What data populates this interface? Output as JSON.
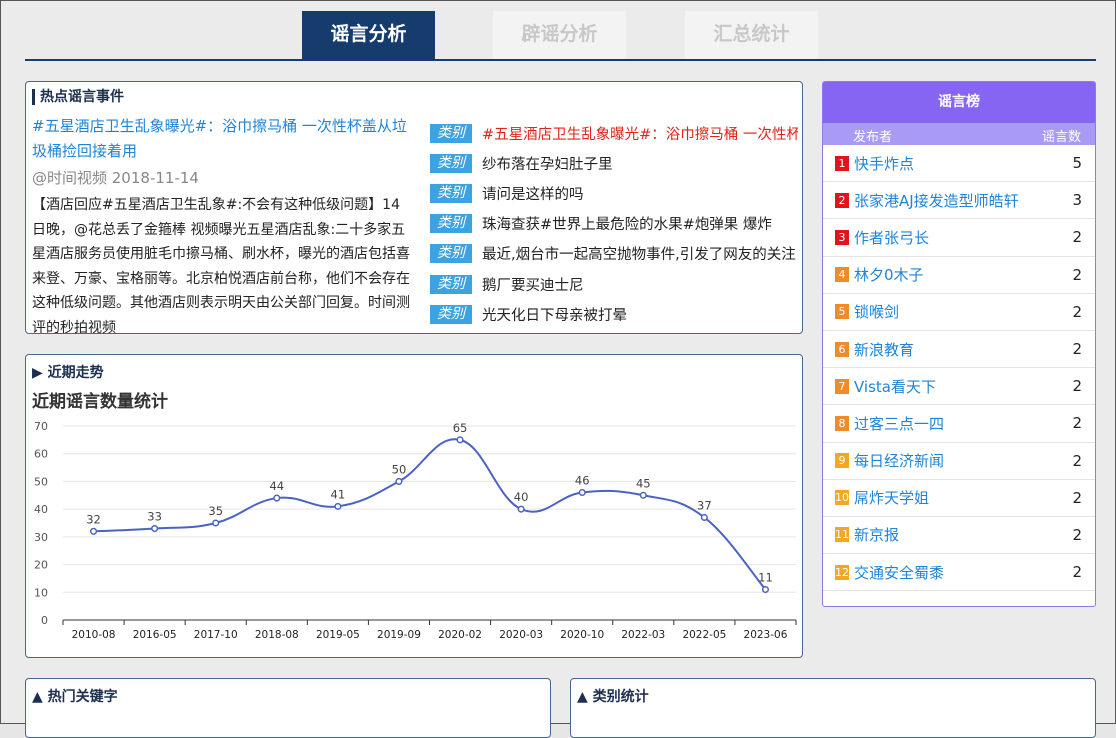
{
  "tabs": [
    {
      "label": "谣言分析"
    },
    {
      "label": "辟谣分析"
    },
    {
      "label": "汇总统计"
    }
  ],
  "hot": {
    "title": "热点谣言事件",
    "headline": "#五星酒店卫生乱象曝光#：浴巾擦马桶 一次性杯盖从垃圾桶捡回接着用",
    "meta": "@时间视频 2018-11-14",
    "body": "【酒店回应#五星酒店卫生乱象#:不会有这种低级问题】14日晚，@花总丢了金箍棒 视频曝光五星酒店乱象:二十多家五星酒店服务员使用脏毛巾擦马桶、刷水杯，曝光的酒店包括喜来登、万豪、宝格丽等。北京柏悦酒店前台称，他们不会存在这种低级问题。其他酒店则表示明天由公关部门回复。时间测评的秒拍视频",
    "tag_label": "类别",
    "rows": [
      {
        "text": "#五星酒店卫生乱象曝光#：浴巾擦马桶 一次性杯盖从垃圾桶捡回接着用"
      },
      {
        "text": "纱布落在孕妇肚子里"
      },
      {
        "text": "请问是这样的吗"
      },
      {
        "text": "珠海查获#世界上最危险的水果#炮弹果 爆炸"
      },
      {
        "text": "最近,烟台市一起高空抛物事件,引发了网友的关注"
      },
      {
        "text": "鹅厂要买迪士尼"
      },
      {
        "text": "光天化日下母亲被打晕"
      }
    ]
  },
  "trend": {
    "title": "近期走势",
    "chart_title": "近期谣言数量统计"
  },
  "chart_data": {
    "type": "line",
    "title": "近期谣言数量统计",
    "categories": [
      "2010-08",
      "2016-05",
      "2017-10",
      "2018-08",
      "2019-05",
      "2019-09",
      "2020-02",
      "2020-03",
      "2020-10",
      "2022-03",
      "2022-05",
      "2023-06"
    ],
    "values": [
      32,
      33,
      35,
      44,
      41,
      50,
      65,
      40,
      46,
      45,
      37,
      11
    ],
    "ylim": [
      0,
      70
    ],
    "yticks": [
      0,
      10,
      20,
      30,
      40,
      50,
      60,
      70
    ],
    "color": "#4a63c3",
    "grid": true
  },
  "rank": {
    "title": "谣言榜",
    "col_publisher": "发布者",
    "col_count": "谣言数",
    "items": [
      {
        "n": "1",
        "name": "快手炸点",
        "count": "5",
        "color": "#e2141b"
      },
      {
        "n": "2",
        "name": "张家港AJ接发造型师皓轩",
        "count": "3",
        "color": "#e2141b"
      },
      {
        "n": "3",
        "name": "作者张弓长",
        "count": "2",
        "color": "#e2141b"
      },
      {
        "n": "4",
        "name": "林夕0木子",
        "count": "2",
        "color": "#f08b2a"
      },
      {
        "n": "5",
        "name": "锁喉剑",
        "count": "2",
        "color": "#f08b2a"
      },
      {
        "n": "6",
        "name": "新浪教育",
        "count": "2",
        "color": "#f08b2a"
      },
      {
        "n": "7",
        "name": "Vista看天下",
        "count": "2",
        "color": "#f08b2a"
      },
      {
        "n": "8",
        "name": "过客三点一四",
        "count": "2",
        "color": "#f08b2a"
      },
      {
        "n": "9",
        "name": "每日经济新闻",
        "count": "2",
        "color": "#f5a623"
      },
      {
        "n": "10",
        "name": "屌炸天学姐",
        "count": "2",
        "color": "#f5a623"
      },
      {
        "n": "11",
        "name": "新京报",
        "count": "2",
        "color": "#f5a623"
      },
      {
        "n": "12",
        "name": "交通安全蜀黍",
        "count": "2",
        "color": "#f5a623"
      }
    ]
  },
  "keywords": {
    "title": "热门关键字"
  },
  "category": {
    "title": "类别统计"
  }
}
